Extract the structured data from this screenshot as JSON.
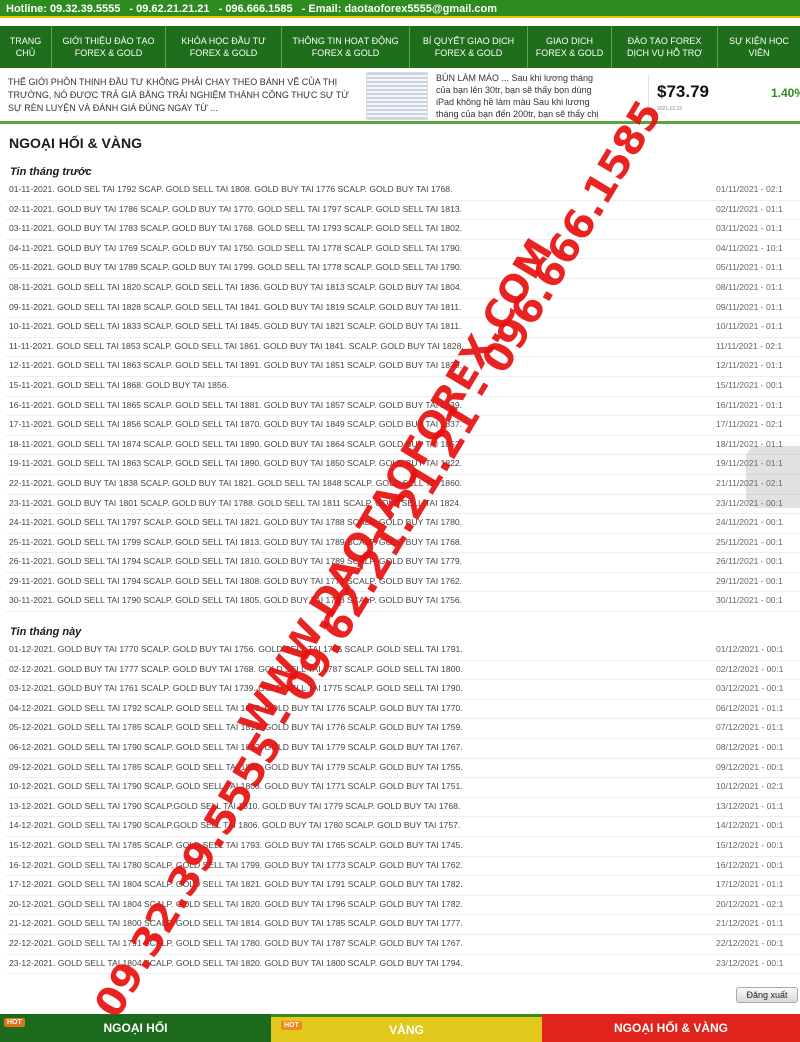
{
  "header": {
    "hotline": "Hotline: 09.32.39.5555",
    "phone2": "- 09.62.21.21.21",
    "phone3": "- 096.666.1585",
    "email": "- Email: daotaoforex5555@gmail.com"
  },
  "nav": {
    "items": [
      {
        "label": "TRANG CHỦ"
      },
      {
        "label": "GIỚI THIỆU ĐÀO TẠO FOREX & GOLD"
      },
      {
        "label": "KHÓA HỌC ĐẦU TƯ FOREX & GOLD"
      },
      {
        "label": "THÔNG TIN HOẠT ĐỘNG FOREX & GOLD"
      },
      {
        "label": "BÍ QUYẾT GIAO DỊCH FOREX & GOLD"
      },
      {
        "label": "GIAO DỊCH FOREX & GOLD"
      },
      {
        "label": "ĐÀO TẠO FOREX DỊCH VỤ HỖ TRỢ"
      },
      {
        "label": "SỰ KIỆN HỌC VIÊN"
      }
    ]
  },
  "banner": {
    "text": "THẾ GIỚI PHỒN THỊNH ĐẦU TƯ KHÔNG PHẢI CHẠY THEO BÁNH VẼ CỦA THỊ TRƯỜNG, NÓ ĐƯỢC TRẢ GIÁ BẰNG TRẢI NGHIỆM THÀNH CÔNG THỰC SỰ TỪ SỰ RÈN LUYỆN VÀ ĐÁNH GIÁ ĐÚNG NGAY TỪ ...",
    "article": "BÚN LÀM MÀO ... Sau khi lương tháng của bạn lên 30tr, bạn sẽ thấy bọn dùng iPad không hề làm màu Sau khi lương tháng của bạn đến 200tr, bạn sẽ thấy chị em cầm LV hàng fake...",
    "ticker_price": "$73.79",
    "ticker_change": "1.40%",
    "ticker_meta": "2021.12.23"
  },
  "main": {
    "section_title": "NGOẠI HỐI & VÀNG",
    "previous_month_title": "Tin tháng trước",
    "previous_month": [
      {
        "text": "01-11-2021. GOLD SEL TAI 1792 SCAP. GOLD SELL TAI 1808. GOLD BUY TAI 1776 SCALP. GOLD BUY TAI 1768.",
        "date": "01/11/2021 - 02:1"
      },
      {
        "text": "02-11-2021. GOLD BUY TAI 1786 SCALP. GOLD BUY TAI 1770. GOLD SELL TAI 1797 SCALP. GOLD SELL TAI 1813.",
        "date": "02/11/2021 - 01:1"
      },
      {
        "text": "03-11-2021. GOLD BUY TAI 1783 SCALP. GOLD BUY TAI 1768. GOLD SELL TAI 1793 SCALP. GOLD SELL TAI 1802.",
        "date": "03/11/2021 - 01:1"
      },
      {
        "text": "04-11-2021. GOLD BUY TAI 1769 SCALP. GOLD BUY TAI 1750. GOLD SELL TAI 1778 SCALP. GOLD SELL TAI 1790.",
        "date": "04/11/2021 - 10:1"
      },
      {
        "text": "05-11-2021. GOLD BUY TAI 1789 SCALP. GOLD BUY TAI 1799. GOLD SELL TAI 1778 SCALP. GOLD SELL TAI 1790.",
        "date": "05/11/2021 - 01:1"
      },
      {
        "text": "08-11-2021. GOLD SELL TAI 1820 SCALP. GOLD SELL TAI 1836. GOLD BUY TAI 1813 SCALP. GOLD BUY TAI 1804.",
        "date": "08/11/2021 - 01:1"
      },
      {
        "text": "09-11-2021. GOLD SELL TAI 1828 SCALP. GOLD SELL TAI 1841. GOLD BUY TAI 1819 SCALP. GOLD BUY TAI 1811.",
        "date": "09/11/2021 - 01:1"
      },
      {
        "text": "10-11-2021. GOLD SELL TAI 1833 SCALP. GOLD SELL TAI 1845. GOLD BUY TAI 1821 SCALP. GOLD BUY TAI 1811.",
        "date": "10/11/2021 - 01:1"
      },
      {
        "text": "11-11-2021. GOLD SELL TAI 1853 SCALP. GOLD SELL TAI 1861. GOLD BUY TAI 1841. SCALP. GOLD BUY TAI 1828.",
        "date": "11/11/2021 - 02:1"
      },
      {
        "text": "12-11-2021. GOLD SELL TAI 1863 SCALP. GOLD SELL TAI 1891. GOLD BUY TAI 1851 SCALP. GOLD BUY TAI 1839.",
        "date": "12/11/2021 - 01:1"
      },
      {
        "text": "15-11-2021. GOLD SELL TAI 1868. GOLD BUY TAI 1856.",
        "date": "15/11/2021 - 00:1"
      },
      {
        "text": "16-11-2021. GOLD SELL TAI 1865 SCALP. GOLD SELL TAI 1881. GOLD BUY TAI 1857 SCALP. GOLD BUY TAI 1839.",
        "date": "16/11/2021 - 01:1"
      },
      {
        "text": "17-11-2021. GOLD SELL TAI 1856 SCALP. GOLD SELL TAI 1870. GOLD BUY TAI 1849 SCALP. GOLD BUY TAI 1837.",
        "date": "17/11/2021 - 02:1"
      },
      {
        "text": "18-11-2021. GOLD SELL TAI 1874 SCALP. GOLD SELL TAI 1890. GOLD BUY TAI 1864 SCALP. GOLD BUY TAI 1852.",
        "date": "18/11/2021 - 01:1"
      },
      {
        "text": "19-11-2021. GOLD SELL TAI 1863 SCALP. GOLD SELL TAI 1890. GOLD BUY TAI 1850 SCALP. GOLD BUY TAI 1822.",
        "date": "19/11/2021 - 01:1"
      },
      {
        "text": "22-11-2021. GOLD BUY TAI 1838 SCALP. GOLD BUY TAI 1821. GOLD SELL TAI 1848 SCALP. GOLD SELL TAI 1860.",
        "date": "21/11/2021 - 02:1"
      },
      {
        "text": "23-11-2021. GOLD BUY TAI 1801 SCALP. GOLD BUY TAI 1788. GOLD SELL TAI 1811 SCALP. GOLD SELL TAI 1824.",
        "date": "23/11/2021 - 00:1"
      },
      {
        "text": "24-11-2021. GOLD SELL TAI 1797 SCALP. GOLD SELL TAI 1821. GOLD BUY TAI 1788 SCALP. GOLD BUY TAI 1780.",
        "date": "24/11/2021 - 00:1"
      },
      {
        "text": "25-11-2021. GOLD SELL TAI 1799 SCALP. GOLD SELL TAI 1813. GOLD BUY TAI 1789 SCALP. GOLD BUY TAI 1768.",
        "date": "25/11/2021 - 00:1"
      },
      {
        "text": "26-11-2021. GOLD SELL TAI 1794 SCALP. GOLD SELL TAI 1810. GOLD BUY TAI 1789 SCALP. GOLD BUY TAI 1779.",
        "date": "26/11/2021 - 00:1"
      },
      {
        "text": "29-11-2021. GOLD SELL TAI 1794 SCALP. GOLD SELL TAI 1808. GOLD BUY TAI 1779 SCALP. GOLD BUY TAI 1762.",
        "date": "29/11/2021 - 00:1"
      },
      {
        "text": "30-11-2021. GOLD SELL TAI 1790 SCALP. GOLD SELL TAI 1805. GOLD BUY TAI 1778 SCALP. GOLD BUY TAI 1756.",
        "date": "30/11/2021 - 00:1"
      }
    ],
    "this_month_title": "Tin tháng này",
    "this_month": [
      {
        "text": "01-12-2021. GOLD BUY TAI 1770 SCALP. GOLD BUY TAI 1756. GOLD SELL TAI 1785 SCALP. GOLD SELL TAI 1791.",
        "date": "01/12/2021 - 00:1"
      },
      {
        "text": "02-12-2021. GOLD BUY TAI 1777 SCALP. GOLD BUY TAI 1768. GOLD SELL TAI 1787 SCALP. GOLD SELL TAI 1800.",
        "date": "02/12/2021 - 00:1"
      },
      {
        "text": "03-12-2021. GOLD BUY TAI 1761 SCALP. GOLD BUY TAI 1739. GOLD SELL TAI 1775 SCALP. GOLD SELL TAI 1790.",
        "date": "03/12/2021 - 00:1"
      },
      {
        "text": "04-12-2021. GOLD SELL TAI 1792 SCALP. GOLD SELL TAI 1813. GOLD BUY TAI 1776 SCALP. GOLD BUY TAI 1770.",
        "date": "06/12/2021 - 01:1"
      },
      {
        "text": "05-12-2021. GOLD SELL TAI 1785 SCALP. GOLD SELL TAI 1813. GOLD BUY TAI 1776 SCALP. GOLD BUY TAI 1759.",
        "date": "07/12/2021 - 01:1"
      },
      {
        "text": "06-12-2021. GOLD SELL TAI 1790 SCALP. GOLD SELL TAI 1813. GOLD BUY TAI 1779 SCALP. GOLD BUY TAI 1767.",
        "date": "08/12/2021 - 00:1"
      },
      {
        "text": "09-12-2021. GOLD SELL TAI 1785 SCALP. GOLD SELL TAI 1808. GOLD BUY TAI 1779 SCALP. GOLD BUY TAI 1755.",
        "date": "09/12/2021 - 00:1"
      },
      {
        "text": "10-12-2021. GOLD SELL TAI 1790 SCALP. GOLD SELL TAI 1808. GOLD BUY TAI 1771 SCALP. GOLD BUY TAI 1751.",
        "date": "10/12/2021 - 02:1"
      },
      {
        "text": "13-12-2021. GOLD SELL TAI 1790 SCALP.GOLD SELL TAI 1810. GOLD BUY TAI 1779 SCALP. GOLD BUY TAI 1768.",
        "date": "13/12/2021 - 01:1"
      },
      {
        "text": "14-12-2021. GOLD SELL TAI 1790 SCALP.GOLD SELL TAI 1806. GOLD BUY TAI 1780 SCALP. GOLD BUY TAI 1757.",
        "date": "14/12/2021 - 00:1"
      },
      {
        "text": "15-12-2021. GOLD SELL TAI 1785 SCALP. GOLD SELL TAI 1793. GOLD BUY TAI 1765 SCALP. GOLD BUY TAI 1745.",
        "date": "15/12/2021 - 00:1"
      },
      {
        "text": "16-12-2021. GOLD SELL TAI 1780 SCALP. GOLD SELL TAI 1799. GOLD BUY TAI 1773 SCALP. GOLD BUY TAI 1762.",
        "date": "16/12/2021 - 00:1"
      },
      {
        "text": "17-12-2021. GOLD SELL TAI 1804 SCALP. GOLD SELL TAI 1821. GOLD BUY TAI 1791 SCALP. GOLD BUY TAI 1782.",
        "date": "17/12/2021 - 01:1"
      },
      {
        "text": "20-12-2021. GOLD SELL TAI 1804 SCALP. GOLD SELL TAI 1820. GOLD BUY TAI 1796 SCALP. GOLD BUY TAI 1782.",
        "date": "20/12/2021 - 02:1"
      },
      {
        "text": "21-12-2021. GOLD SELL TAI 1800 SCALP. GOLD SELL TAI 1814. GOLD BUY TAI 1785 SCALP. GOLD BUY TAI 1777.",
        "date": "21/12/2021 - 01:1"
      },
      {
        "text": "22-12-2021. GOLD SELL TAI 1791 SCALP. GOLD SELL TAI 1780. GOLD BUY TAI 1787 SCALP. GOLD BUY TAI 1767.",
        "date": "22/12/2021 - 00:1"
      },
      {
        "text": "23-12-2021. GOLD SELL TAI 1804 SCALP. GOLD SELL TAI 1820. GOLD BUY TAI 1800 SCALP. GOLD BUY TAI 1794.",
        "date": "23/12/2021 - 00:1"
      }
    ],
    "logout_label": "Đăng xuất"
  },
  "bottom_tabs": [
    {
      "label": "NGOẠI HỐI",
      "badge": "HOT"
    },
    {
      "label": "VÀNG",
      "badge": "HOT"
    },
    {
      "label": "NGOẠI HỐI & VÀNG"
    }
  ],
  "watermarks": {
    "line1": "09.32.39.5555 - 09.62.21.21.21 - 096.666.1585",
    "line2": "WWW.DAOTAOFOREX.COM",
    "color": "#e81010"
  },
  "colors": {
    "brand_green": "#1f6e1c",
    "hotline_green": "#2e8b1f",
    "tab_yellow": "#e3c81c",
    "tab_red": "#e0231b"
  }
}
